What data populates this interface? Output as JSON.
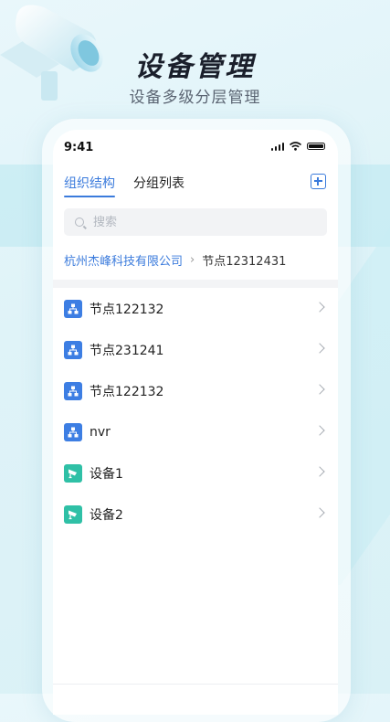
{
  "hero": {
    "title": "设备管理",
    "subtitle": "设备多级分层管理"
  },
  "status_bar": {
    "time": "9:41"
  },
  "tabs": [
    {
      "label": "组织结构",
      "active": true
    },
    {
      "label": "分组列表",
      "active": false
    }
  ],
  "search": {
    "placeholder": "搜索",
    "value": ""
  },
  "breadcrumb": {
    "root": "杭州杰峰科技有限公司",
    "current": "节点12312431"
  },
  "list": [
    {
      "label": "节点122132",
      "icon": "org-node-icon"
    },
    {
      "label": "节点231241",
      "icon": "org-node-icon"
    },
    {
      "label": "节点122132",
      "icon": "org-node-icon"
    },
    {
      "label": "nvr",
      "icon": "org-node-icon"
    },
    {
      "label": "设备1",
      "icon": "camera-device-icon"
    },
    {
      "label": "设备2",
      "icon": "camera-device-icon"
    }
  ],
  "colors": {
    "accent": "#3b7bdc",
    "org_icon": "#3d7ee3",
    "device_icon": "#2fc0a6"
  }
}
